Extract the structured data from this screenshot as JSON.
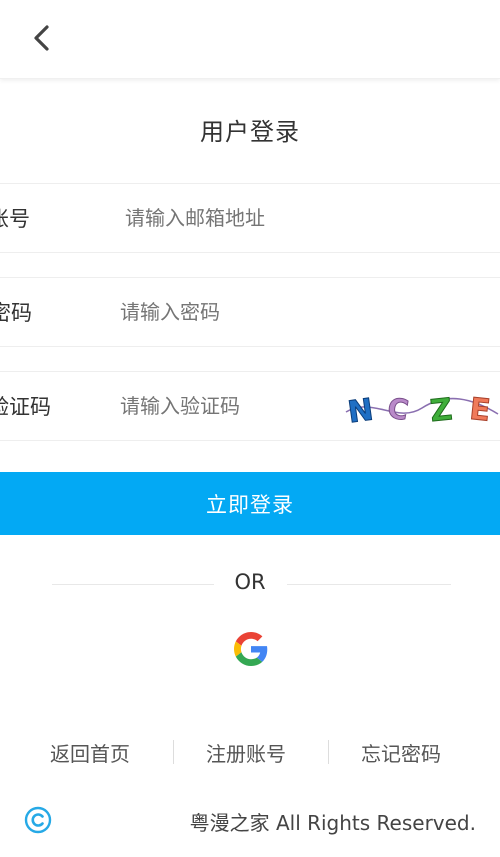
{
  "header": {
    "back_icon": "chevron-left-icon"
  },
  "page": {
    "title": "用户登录"
  },
  "form": {
    "account": {
      "label": "账号",
      "placeholder": "请输入邮箱地址",
      "value": ""
    },
    "password": {
      "label": "密码",
      "placeholder": "请输入密码",
      "value": ""
    },
    "captcha": {
      "label": "验证码",
      "placeholder": "请输入验证码",
      "value": "",
      "image_text": "NCZE"
    }
  },
  "login_button": {
    "label": "立即登录"
  },
  "divider": {
    "text": "OR"
  },
  "social": {
    "google_icon": "google-icon"
  },
  "links": [
    {
      "label": "返回首页"
    },
    {
      "label": "注册账号"
    },
    {
      "label": "忘记密码"
    }
  ],
  "footer": {
    "copyright_icon": "copyright-icon",
    "text": "粤漫之家 All Rights Reserved."
  },
  "colors": {
    "primary": "#03a9f4",
    "text": "#333333",
    "placeholder": "#999999",
    "border": "#eeeeee"
  }
}
